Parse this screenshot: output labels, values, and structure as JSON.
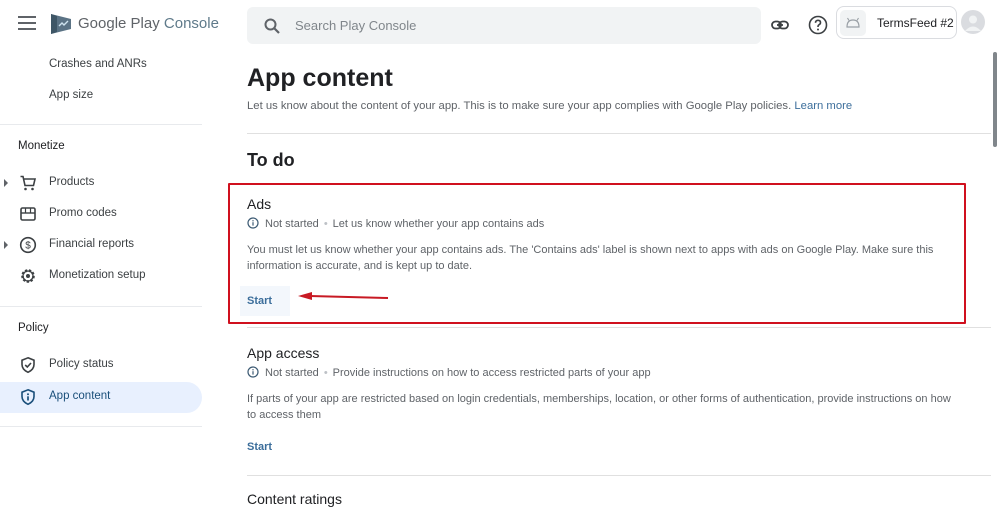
{
  "header": {
    "brand_main": "Google Play",
    "brand_suffix": "Console",
    "search_placeholder": "Search Play Console",
    "app_name": "TermsFeed #2",
    "icons": [
      "menu-icon",
      "play-console-logo",
      "search-icon",
      "link-icon",
      "help-icon",
      "android-icon",
      "account-icon"
    ]
  },
  "sidebar": {
    "top_items": [
      {
        "label": "Crashes and ANRs"
      },
      {
        "label": "App size"
      }
    ],
    "sections": [
      {
        "title": "Monetize",
        "items": [
          {
            "label": "Products",
            "icon": "cart-icon",
            "expandable": true
          },
          {
            "label": "Promo codes",
            "icon": "store-icon",
            "expandable": false
          },
          {
            "label": "Financial reports",
            "icon": "dollar-icon",
            "expandable": true
          },
          {
            "label": "Monetization setup",
            "icon": "gear-icon",
            "expandable": false
          }
        ]
      },
      {
        "title": "Policy",
        "items": [
          {
            "label": "Policy status",
            "icon": "shield-check-icon",
            "expandable": false
          },
          {
            "label": "App content",
            "icon": "shield-info-icon",
            "expandable": false,
            "active": true
          }
        ]
      }
    ]
  },
  "main": {
    "title": "App content",
    "subtitle": "Let us know about the content of your app. This is to make sure your app complies with Google Play policies.",
    "learn_more": "Learn more",
    "section_title": "To do",
    "cards": [
      {
        "title": "Ads",
        "status": "Not started",
        "summary": "Let us know whether your app contains ads",
        "description": "You must let us know whether your app contains ads. The 'Contains ads' label is shown next to apps with ads on Google Play. Make sure this information is accurate, and is kept up to date.",
        "action": "Start"
      },
      {
        "title": "App access",
        "status": "Not started",
        "summary": "Provide instructions on how to access restricted parts of your app",
        "description": "If parts of your app are restricted based on login credentials, memberships, location, or other forms of authentication, provide instructions on how to access them",
        "action": "Start"
      },
      {
        "title": "Content ratings"
      }
    ]
  },
  "annotation": {
    "highlight_color": "#d0101e"
  }
}
